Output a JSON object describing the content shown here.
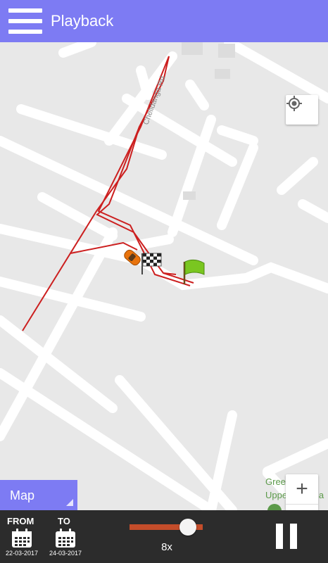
{
  "header": {
    "title": "Playback",
    "menu_icon": "hamburger-menu-icon"
  },
  "map": {
    "road_label": "Chelidanga Rd",
    "place_line1": "Green Park",
    "place_line2": "Upper Chelida",
    "map_type_label": "Map",
    "zoom_in_label": "+",
    "zoom_out_label": "−",
    "route_color": "#cc1f1f"
  },
  "controls": {
    "from_label": "FROM",
    "from_date": "22-03-2017",
    "to_label": "TO",
    "to_date": "24-03-2017",
    "speed_label": "8x",
    "speed_fraction": 0.8
  },
  "colors": {
    "accent": "#7d7bf3",
    "bottom_bar": "#2c2c2c",
    "slider": "#c44d2a"
  }
}
